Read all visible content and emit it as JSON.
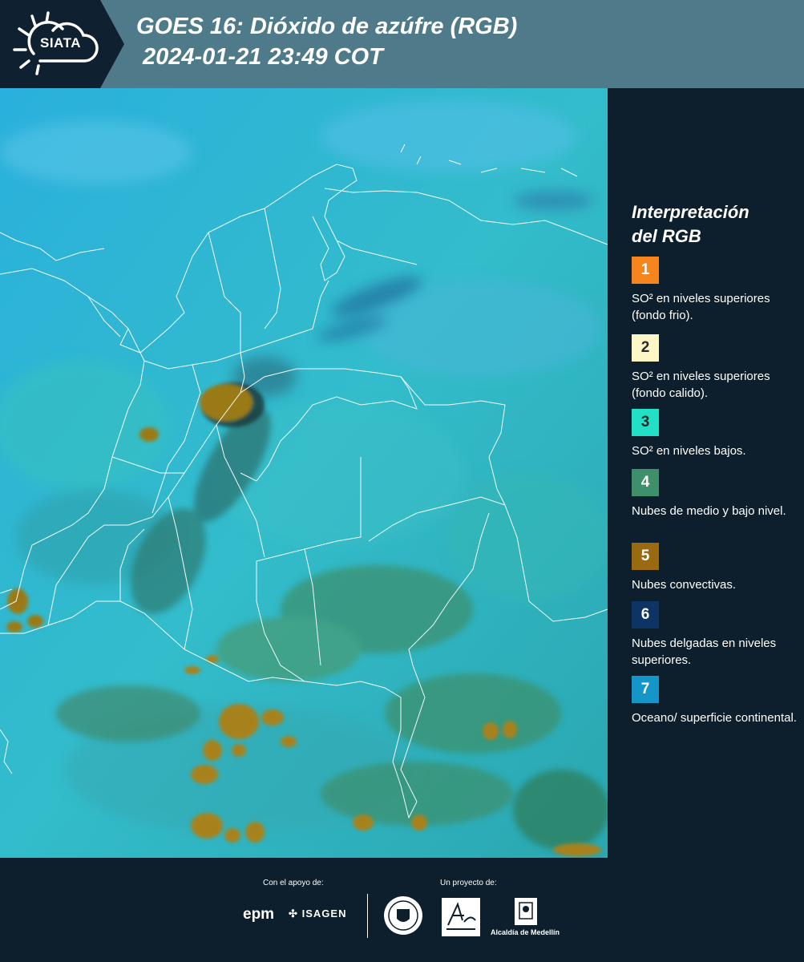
{
  "header": {
    "logo_text": "SIATA",
    "title_line1": "GOES 16: Dióxido de azúfre (RGB)",
    "title_line2": "2024-01-21 23:49 COT"
  },
  "legend": {
    "title_line1": "Interpretación",
    "title_line2": "del RGB",
    "items": [
      {
        "number": "1",
        "color": "#f7851e",
        "text": "SO² en niveles superiores (fondo frio)."
      },
      {
        "number": "2",
        "color": "#fdf7c5",
        "text": "SO² en niveles superiores (fondo calido)."
      },
      {
        "number": "3",
        "color": "#22e0c6",
        "text": "SO² en niveles bajos."
      },
      {
        "number": "4",
        "color": "#3e8f6a",
        "text": "Nubes de medio y bajo nivel."
      },
      {
        "number": "5",
        "color": "#9a6a10",
        "text": "Nubes convectivas."
      },
      {
        "number": "6",
        "color": "#0e3466",
        "text": "Nubes delgadas en niveles superiores."
      },
      {
        "number": "7",
        "color": "#1596c9",
        "text": "Oceano/ superficie continental."
      }
    ]
  },
  "footer": {
    "support_label": "Con el apoyo de:",
    "support_logos": [
      "epm",
      "ISAGEN"
    ],
    "project_label": "Un proyecto de:",
    "project_logos": [
      "Medellín seal",
      "Área Metropolitana Valle de Aburrá",
      "Alcaldía de Medellín"
    ],
    "epm_text": "epm",
    "isagen_text": "ISAGEN",
    "alcaldia_text": "Alcaldía de Medellín"
  },
  "colors": {
    "background": "#0d1e2c",
    "header_bar": "#4f7a8a",
    "ocean": "#2fb6d8",
    "land": "#33b3b8",
    "vegetation_clouds": "#3e8f6a",
    "convective": "#9a6a10"
  }
}
